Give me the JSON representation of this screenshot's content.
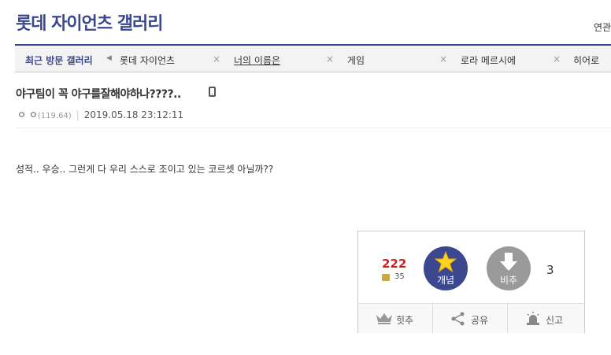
{
  "header": {
    "gallery_title": "롯데 자이언츠 갤러리",
    "right_text": "연관"
  },
  "recent": {
    "label": "최근 방문 갤러리",
    "items": [
      {
        "label": "롯데 자이언츠"
      },
      {
        "label": "너의 이름은"
      },
      {
        "label": "게임"
      },
      {
        "label": "로라 메르시에"
      },
      {
        "label": "히어로"
      }
    ],
    "close_glyph": "×"
  },
  "post": {
    "title": "야구팀이 꼭 야구를잘해야하나????..",
    "author": "ㅇ ㅇ",
    "ip": "(119.64)",
    "datetime": "2019.05.18 23:12:11",
    "body": "성적.. 우승.. 그런게 다 우리 스스로 조이고 있는 코르셋 아닐까??"
  },
  "recommend": {
    "up_count": "222",
    "fix_count": "35",
    "up_label": "개념",
    "down_label": "비추",
    "down_count": "3",
    "up_color": "#3b4890",
    "down_color": "#9a9a9a",
    "star_color": "#ffd21f"
  },
  "actions": [
    {
      "label": "힛추",
      "icon": "crown-icon"
    },
    {
      "label": "공유",
      "icon": "share-icon"
    },
    {
      "label": "신고",
      "icon": "siren-icon"
    }
  ]
}
